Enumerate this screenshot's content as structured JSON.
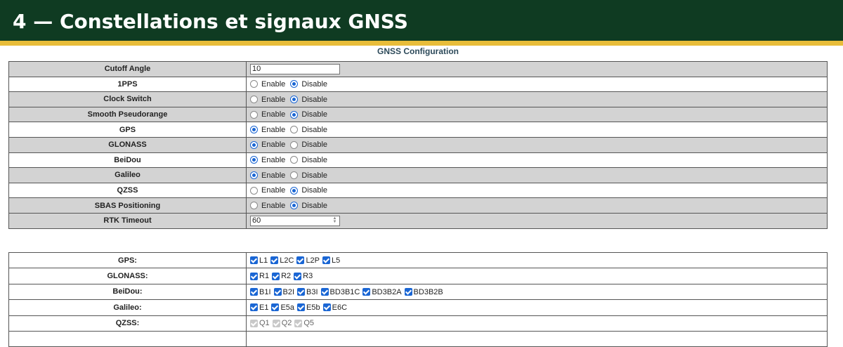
{
  "header": {
    "title": "4 — Constellations et signaux GNSS"
  },
  "section": {
    "title": "GNSS Configuration"
  },
  "enable_label": "Enable",
  "disable_label": "Disable",
  "config": {
    "cutoff": {
      "label": "Cutoff Angle",
      "value": "10"
    },
    "pps": {
      "label": "1PPS",
      "selected": "Disable"
    },
    "clock": {
      "label": "Clock Switch",
      "selected": "Disable"
    },
    "smooth": {
      "label": "Smooth Pseudorange",
      "selected": "Disable"
    },
    "gps": {
      "label": "GPS",
      "selected": "Enable"
    },
    "glonass": {
      "label": "GLONASS",
      "selected": "Enable"
    },
    "beidou": {
      "label": "BeiDou",
      "selected": "Enable"
    },
    "galileo": {
      "label": "Galileo",
      "selected": "Enable"
    },
    "qzss": {
      "label": "QZSS",
      "selected": "Disable"
    },
    "sbas": {
      "label": "SBAS Positioning",
      "selected": "Disable"
    },
    "rtk": {
      "label": "RTK Timeout",
      "value": "60"
    }
  },
  "signals": {
    "gps": {
      "label": "GPS:",
      "items": [
        {
          "name": "L1",
          "checked": true
        },
        {
          "name": "L2C",
          "checked": true
        },
        {
          "name": "L2P",
          "checked": true
        },
        {
          "name": "L5",
          "checked": true
        }
      ]
    },
    "glonass": {
      "label": "GLONASS:",
      "items": [
        {
          "name": "R1",
          "checked": true
        },
        {
          "name": "R2",
          "checked": true
        },
        {
          "name": "R3",
          "checked": true
        }
      ]
    },
    "beidou": {
      "label": "BeiDou:",
      "items": [
        {
          "name": "B1I",
          "checked": true
        },
        {
          "name": "B2I",
          "checked": true
        },
        {
          "name": "B3I",
          "checked": true
        },
        {
          "name": "BD3B1C",
          "checked": true
        },
        {
          "name": "BD3B2A",
          "checked": true
        },
        {
          "name": "BD3B2B",
          "checked": true
        }
      ]
    },
    "galileo": {
      "label": "Galileo:",
      "items": [
        {
          "name": "E1",
          "checked": true
        },
        {
          "name": "E5a",
          "checked": true
        },
        {
          "name": "E5b",
          "checked": true
        },
        {
          "name": "E6C",
          "checked": true
        }
      ]
    },
    "qzss": {
      "label": "QZSS:",
      "items": [
        {
          "name": "Q1",
          "checked": true,
          "disabled": true
        },
        {
          "name": "Q2",
          "checked": true,
          "disabled": true
        },
        {
          "name": "Q5",
          "checked": true,
          "disabled": true
        }
      ]
    }
  }
}
